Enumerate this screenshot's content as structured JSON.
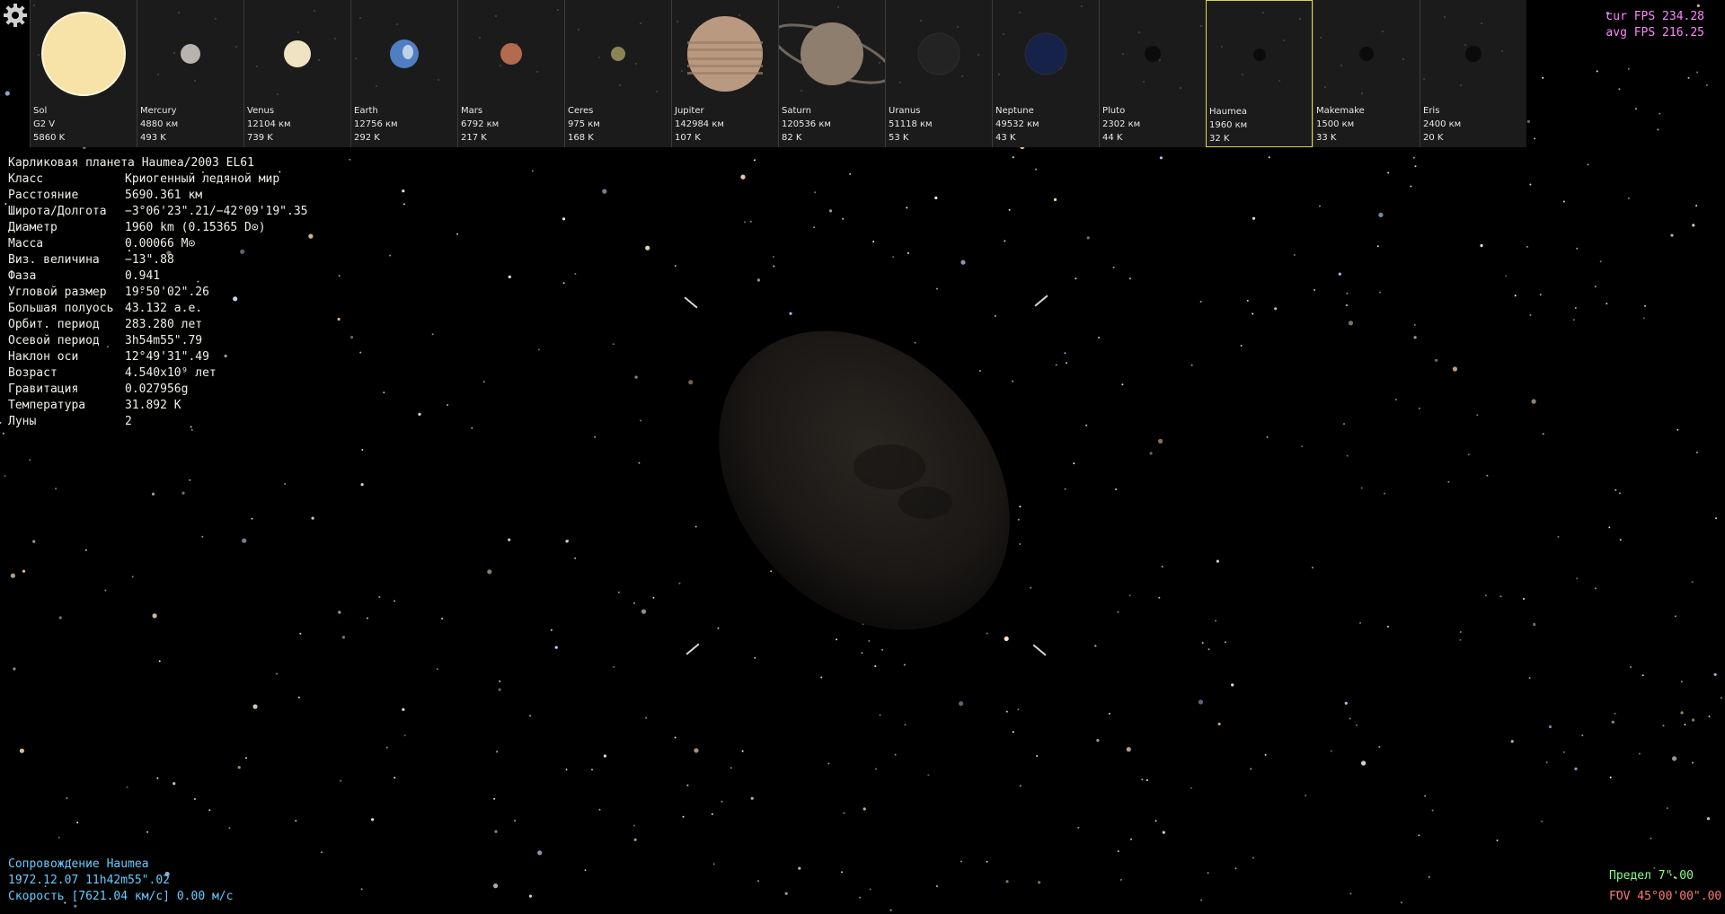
{
  "gear_icon": "gear-icon",
  "bodies": [
    {
      "name": "Sol",
      "line2": "G2 V",
      "line3": "5860 K",
      "color": "#f7e2a8",
      "r": 46
    },
    {
      "name": "Mercury",
      "line2": "4880 км",
      "line3": "493 K",
      "color": "#b8b3ad",
      "r": 11
    },
    {
      "name": "Venus",
      "line2": "12104 км",
      "line3": "739 K",
      "color": "#efe3c4",
      "r": 15
    },
    {
      "name": "Earth",
      "line2": "12756 км",
      "line3": "292 K",
      "color": "#4f7fc2",
      "r": 16
    },
    {
      "name": "Mars",
      "line2": "6792 км",
      "line3": "217 K",
      "color": "#b36a4e",
      "r": 12
    },
    {
      "name": "Ceres",
      "line2": "975 км",
      "line3": "168 K",
      "color": "#8a8454",
      "r": 8
    },
    {
      "name": "Jupiter",
      "line2": "142984 км",
      "line3": "107 K",
      "color": "#b99a80",
      "r": 42
    },
    {
      "name": "Saturn",
      "line2": "120536 км",
      "line3": "82 K",
      "color": "#8e7e6e",
      "r": 35
    },
    {
      "name": "Uranus",
      "line2": "51118 км",
      "line3": "53 K",
      "color": "#232323",
      "r": 23
    },
    {
      "name": "Neptune",
      "line2": "49532 км",
      "line3": "43 K",
      "color": "#16224a",
      "r": 23
    },
    {
      "name": "Pluto",
      "line2": "2302 км",
      "line3": "44 K",
      "color": "#0b0b0b",
      "r": 9
    },
    {
      "name": "Haumea",
      "line2": "1960 км",
      "line3": "32 K",
      "color": "#0b0b0b",
      "r": 7
    },
    {
      "name": "Makemake",
      "line2": "1500 км",
      "line3": "33 K",
      "color": "#0b0b0b",
      "r": 8
    },
    {
      "name": "Eris",
      "line2": "2400 км",
      "line3": "20 K",
      "color": "#0b0b0b",
      "r": 9
    }
  ],
  "selected_body": "Haumea",
  "info": {
    "header": "Карликовая планета  Haumea/2003 EL61",
    "rows": [
      {
        "k": "Класс",
        "v": "Криогенный ледяной мир"
      },
      {
        "k": "Расстояние",
        "v": "5690.361 км"
      },
      {
        "k": "Широта/Долгота",
        "v": "−3°06'23\".21/−42°09'19\".35"
      },
      {
        "k": "Диаметр",
        "v": "1960 km (0.15365 D⊙)"
      },
      {
        "k": "Масса",
        "v": "0.00066 M⊙"
      },
      {
        "k": "Виз. величина",
        "v": "−13\".88"
      },
      {
        "k": "Фаза",
        "v": "0.941"
      },
      {
        "k": "Угловой размер",
        "v": "19°50'02\".26"
      },
      {
        "k": "Большая полуось",
        "v": "43.132 а.е."
      },
      {
        "k": "Орбит. период",
        "v": "283.280 лет"
      },
      {
        "k": "Осевой период",
        "v": "3h54m55\".79"
      },
      {
        "k": "Наклон оси",
        "v": "12°49'31\".49"
      },
      {
        "k": "Возраст",
        "v": "4.540x10⁹ лет"
      },
      {
        "k": "Гравитация",
        "v": "0.027956g"
      },
      {
        "k": "Температура",
        "v": "31.892 K"
      },
      {
        "k": "Луны",
        "v": "2"
      }
    ]
  },
  "fps": {
    "cur": "cur FPS 234.28",
    "avg": "avg FPS 216.25"
  },
  "status": {
    "tracking": "Сопровождение Haumea",
    "datetime": "1972.12.07 11h42m55\".02",
    "speed": "Скорость [7621.04 км/с] 0.00 м/с"
  },
  "limit": "Предел      7\".00",
  "fov": "FOV 45°00'00\".00",
  "colors": {
    "info_text": "#f0f0e8",
    "fps": "#ff88ff",
    "status": "#66ccff",
    "limit": "#88ff88",
    "fov": "#ff7777",
    "selected_border": "#d8d844"
  }
}
